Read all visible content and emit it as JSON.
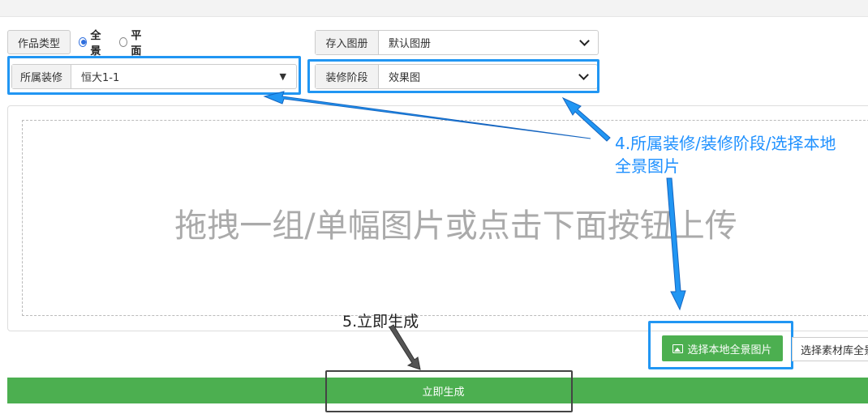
{
  "form": {
    "work_type": {
      "label": "作品类型",
      "options": [
        {
          "label": "全景",
          "checked": true
        },
        {
          "label": "平面",
          "checked": false
        }
      ]
    },
    "album": {
      "label": "存入图册",
      "value": "默认图册"
    },
    "decoration": {
      "label": "所属装修",
      "value": "恒大1-1"
    },
    "stage": {
      "label": "装修阶段",
      "value": "效果图"
    }
  },
  "dropzone": {
    "text": "拖拽一组/单幅图片或点击下面按钮上传"
  },
  "buttons": {
    "select_local": "选择本地全景图片",
    "select_library": "选择素材库全景",
    "generate": "立即生成"
  },
  "annotations": {
    "step4_line1": "4.所属装修/装修阶段/选择本地",
    "step4_line2": "全景图片",
    "step5": "5.立即生成"
  },
  "colors": {
    "highlight": "#2196f3",
    "green": "#4caf50",
    "radio": "#2f6fde"
  }
}
